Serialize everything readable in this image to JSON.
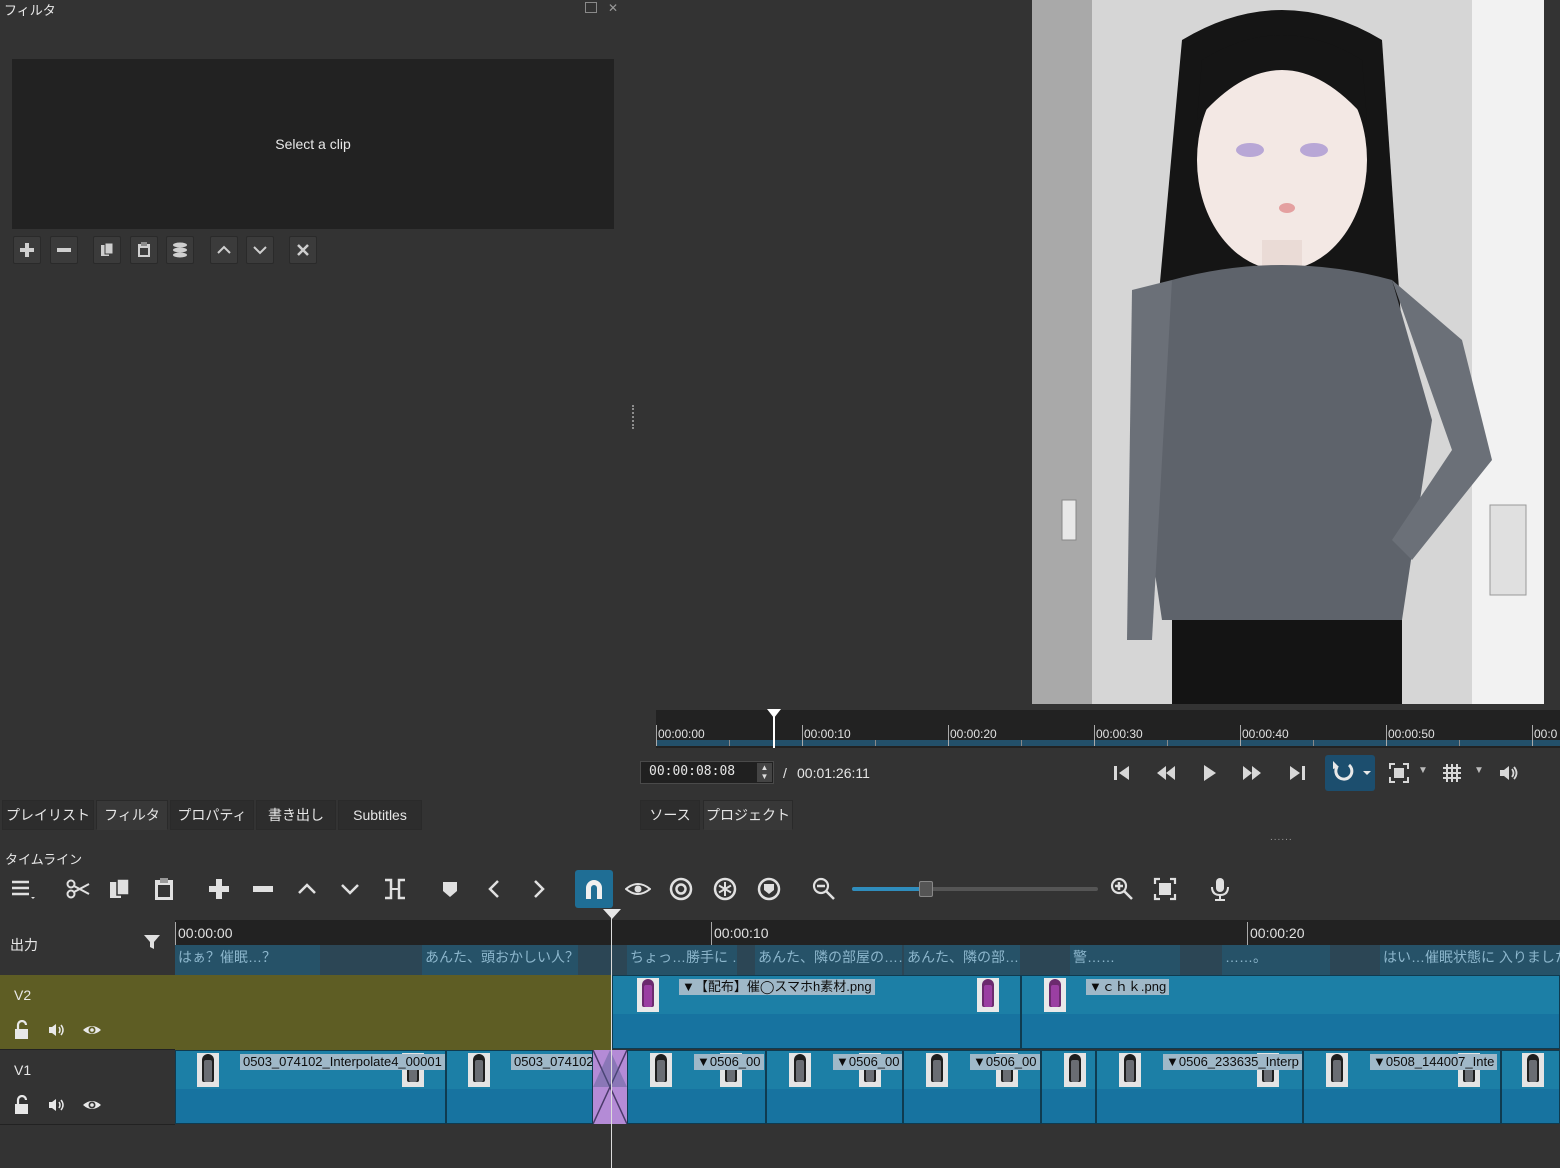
{
  "filter_dock": {
    "title": "フィルタ",
    "placeholder": "Select a clip",
    "toolbar": [
      "plus-icon",
      "minus-icon",
      "copy-icon",
      "paste-icon",
      "stack-icon",
      "chevron-up-icon",
      "chevron-down-icon",
      "close-icon"
    ]
  },
  "left_tabs": [
    "プレイリスト",
    "フィルタ",
    "プロパティ",
    "書き出し",
    "Subtitles"
  ],
  "left_active_tab": "フィルタ",
  "player": {
    "ruler_labels": [
      "00:00:00",
      "00:00:10",
      "00:00:20",
      "00:00:30",
      "00:00:40",
      "00:00:50",
      "00:0"
    ],
    "timecode": "00:00:08:08",
    "separator": "/",
    "duration": "00:01:26:11",
    "controls": [
      "skip-start-icon",
      "rewind-icon",
      "play-icon",
      "fast-forward-icon",
      "skip-end-icon",
      "loop-icon",
      "zoom-fit-icon",
      "grid-icon",
      "volume-icon"
    ]
  },
  "player_tabs": [
    "ソース",
    "プロジェクト"
  ],
  "timeline": {
    "title": "タイムライン",
    "toolbar": [
      "menu-icon",
      "cut-icon",
      "copy-icon",
      "paste-icon",
      "append-icon",
      "remove-icon",
      "lift-icon",
      "overwrite-icon",
      "split-icon",
      "marker-icon",
      "prev-marker-icon",
      "next-marker-icon",
      "snap-icon",
      "scrub-icon",
      "ripple-icon",
      "ripple-all-icon",
      "ripple-markers-icon",
      "zoom-out-icon",
      "zoom-in-icon",
      "zoom-fit-icon",
      "record-audio-icon"
    ],
    "zoom_level": 0.3,
    "ruler_labels": [
      "00:00:00",
      "00:00:10",
      "00:00:20"
    ],
    "output_label": "出力",
    "tracks": [
      {
        "name": "V2"
      },
      {
        "name": "V1"
      }
    ],
    "subtitles": [
      "はぁ？催眠…？",
      "あんた、頭おかしい人？",
      "ちょっ…勝手に …",
      "あんた、隣の部屋の……",
      "あんた、隣の部…",
      "警……",
      "……。",
      "はい…催眠状態に 入りました…"
    ],
    "v2_clips": [
      "【配布】催◯スマホh素材.png",
      "ｃｈｋ.png"
    ],
    "v1_clips": [
      "0503_074102_Interpolate4_00001",
      "0503_074102",
      "0506_00",
      "0506_00",
      "0506_00",
      "",
      "0506_233635_Interp",
      "0508_144007_Inte",
      ""
    ]
  },
  "colors": {
    "accent": "#1f6e95",
    "clip": "#1c7fa6",
    "v2_track": "#5e5d24",
    "transition": "#b48bd6"
  }
}
